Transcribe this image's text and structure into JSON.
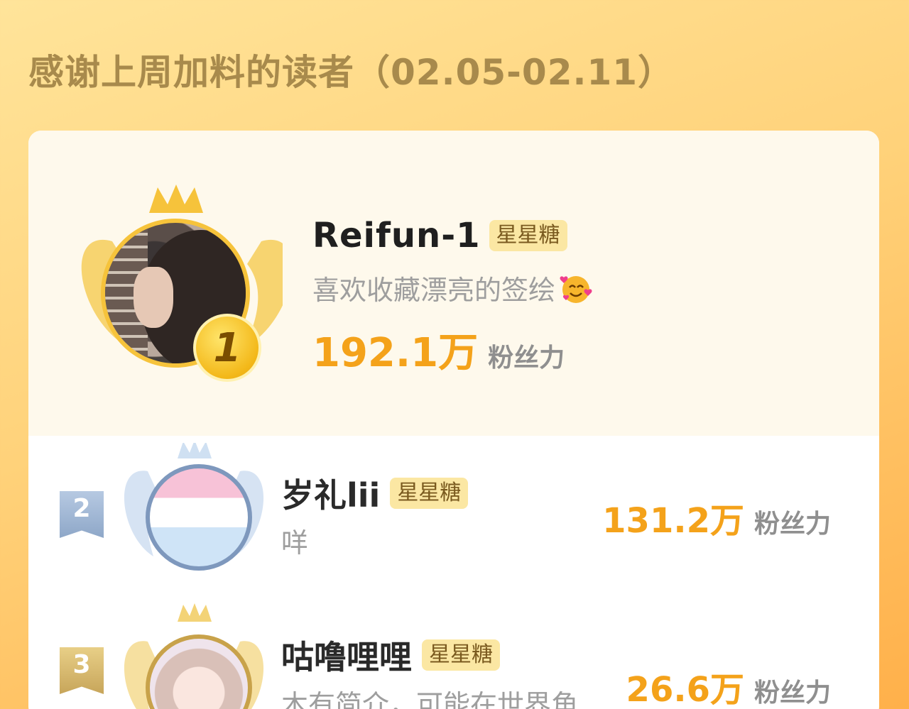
{
  "header": {
    "title": "感谢上周加料的读者（02.05-02.11）"
  },
  "ranks": [
    {
      "rank": "1",
      "name": "Reifun-1",
      "tag": "星星糖",
      "bio": "喜欢收藏漂亮的签绘",
      "emoji_icon": "smiling-face-with-hearts-icon",
      "score": "192.1万",
      "unit": "粉丝力"
    },
    {
      "rank": "2",
      "name": "岁礼lii",
      "tag": "星星糖",
      "bio": "咩",
      "score": "131.2万",
      "unit": "粉丝力"
    },
    {
      "rank": "3",
      "name": "咕噜哩哩",
      "tag": "星星糖",
      "bio": "木有简介，可能在世界角...",
      "score": "26.6万",
      "unit": "粉丝力"
    }
  ],
  "colors": {
    "gold": "#f4a21a",
    "silver_badge": "#8ea7c8",
    "bronze_badge": "#c7a55a",
    "crown": "#f6c33b"
  }
}
